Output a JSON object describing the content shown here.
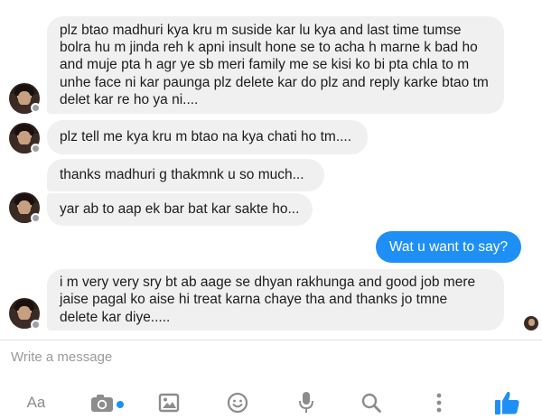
{
  "messages": [
    {
      "direction": "in",
      "text": "plz btao madhuri kya kru m suside kar lu kya and last time tumse\nbolra hu m jinda reh k apni insult hone se to acha h marne k bad ho\nand muje pta h agr ye sb meri family me se kisi ko bi pta chla to m\nunhe face ni kar paunga plz delete kar do plz and reply karke btao tm\ndelet kar re ho ya ni...."
    },
    {
      "direction": "in",
      "text": "plz tell me kya kru m btao na kya chati ho tm...."
    },
    {
      "direction": "in",
      "text": "thanks madhuri g thakmnk u so much..."
    },
    {
      "direction": "in",
      "text": "yar ab to aap ek bar bat kar sakte ho..."
    },
    {
      "direction": "out",
      "text": "Wat u want to say?"
    },
    {
      "direction": "in",
      "text": "i m very very sry bt ab aage se dhyan rakhunga and good job mere\njaise pagal ko aise hi treat karna chaye tha and thanks jo tmne\ndelete kar diye....."
    }
  ],
  "composer": {
    "placeholder": "Write a message"
  },
  "toolbar": {
    "text_format_label": "Aa",
    "icons": [
      "text-format-icon",
      "camera-icon",
      "image-icon",
      "emoji-icon",
      "microphone-icon",
      "search-icon",
      "more-icon",
      "like-icon"
    ]
  },
  "colors": {
    "incoming_bubble": "#f0f0f0",
    "outgoing_bubble": "#1e8ff5",
    "accent": "#1e8ff5",
    "toolbar_icon": "#8c8c8c"
  }
}
